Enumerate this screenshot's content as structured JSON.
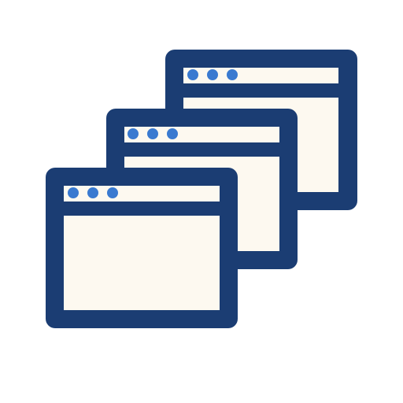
{
  "icon": {
    "name": "multiple-windows-icon",
    "windows": [
      {
        "name": "back-window"
      },
      {
        "name": "middle-window"
      },
      {
        "name": "front-window"
      }
    ]
  },
  "colors": {
    "background": "#ffffff",
    "frame": "#1b3d73",
    "pane": "#fdf9f0",
    "dot": "#3a7ad0"
  }
}
